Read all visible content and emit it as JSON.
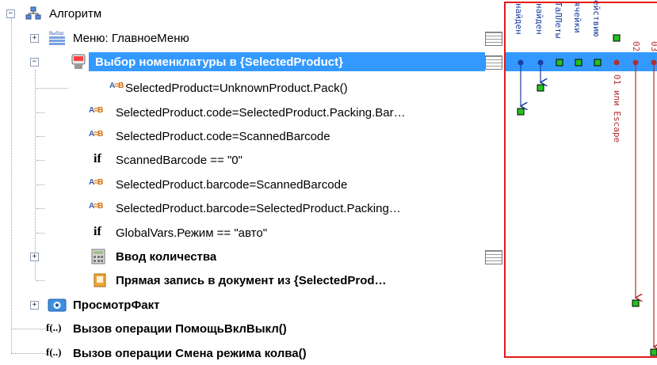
{
  "colors": {
    "selection": "#3399ff",
    "frame": "#e21a1a",
    "blue_arrow": "#1a3fa0",
    "red_arrow": "#b03030",
    "node_green": "#22c222"
  },
  "tree": {
    "root": {
      "label": "Алгоритм",
      "icon": "hierarchy-icon"
    },
    "rows": [
      {
        "label": "Меню: ГлавноеМеню",
        "icon": "menu-icon",
        "bold": false
      },
      {
        "label": "Выбор номенклатуры в {SelectedProduct}",
        "icon": "scanner-icon",
        "bold": true,
        "selected": true
      },
      {
        "label": "SelectedProduct=UnknownProduct.Pack()",
        "icon": "assign-icon",
        "bold": false
      },
      {
        "label": "SelectedProduct.code=SelectedProduct.Packing.Bar…",
        "icon": "assign-icon",
        "bold": false
      },
      {
        "label": "SelectedProduct.code=ScannedBarcode",
        "icon": "assign-icon",
        "bold": false
      },
      {
        "label": "ScannedBarcode == \"0\"",
        "icon": "if-icon",
        "bold": false
      },
      {
        "label": "SelectedProduct.barcode=ScannedBarcode",
        "icon": "assign-icon",
        "bold": false
      },
      {
        "label": "SelectedProduct.barcode=SelectedProduct.Packing…",
        "icon": "assign-icon",
        "bold": false
      },
      {
        "label": "GlobalVars.Режим == \"авто\"",
        "icon": "if-icon",
        "bold": false
      },
      {
        "label": "Ввод количества",
        "icon": "calculator-icon",
        "bold": true
      },
      {
        "label": "Прямая запись в документ из {SelectedProd…",
        "icon": "document-icon",
        "bold": true
      },
      {
        "label": "ПросмотрФакт",
        "icon": "view-icon",
        "bold": true
      },
      {
        "label": "Вызов операции ПомощьВклВыкл()",
        "icon": "function-icon",
        "bold": true
      },
      {
        "label": "Вызов операции Смена режима колва()",
        "icon": "function-icon",
        "bold": true
      }
    ],
    "if_keyword": "if",
    "fx_keyword": "f(..)",
    "menu_icon_text": "Выбор"
  },
  "matrix": {
    "columns": [
      {
        "label": "найден",
        "color": "#1a3fa0"
      },
      {
        "label": "найден",
        "color": "#1a3fa0"
      },
      {
        "label": "ТаЛЛеты",
        "color": "#1a3fa0"
      },
      {
        "label": "ячейки",
        "color": "#1a3fa0"
      },
      {
        "label": "ействию",
        "color": "#1a3fa0"
      },
      {
        "label": "01 или Escape",
        "color": "#b03030"
      },
      {
        "label": "02",
        "color": "#b03030"
      },
      {
        "label": "03",
        "color": "#b03030"
      }
    ]
  }
}
